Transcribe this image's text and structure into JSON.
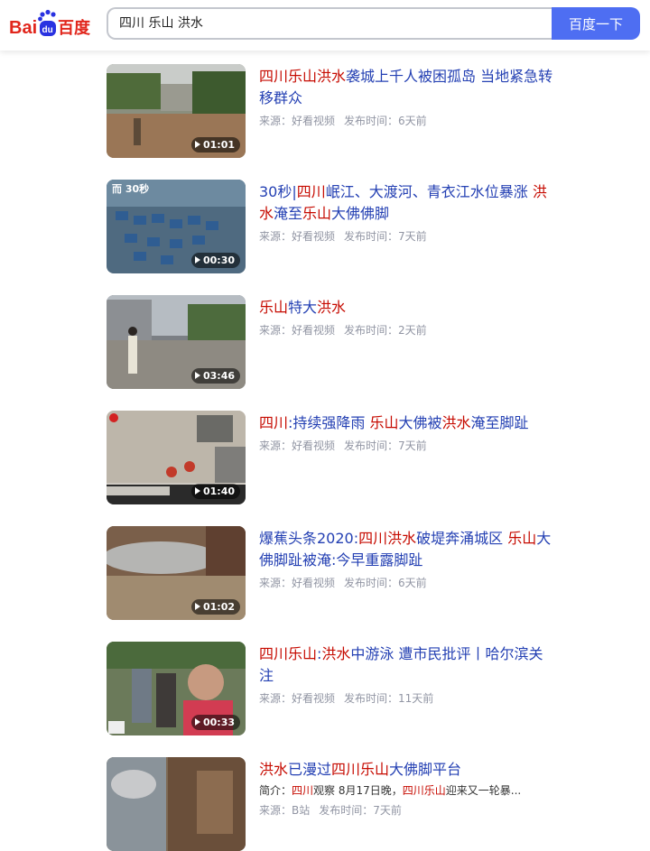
{
  "header": {
    "logo_text": "Bai百度",
    "search_value": "四川 乐山 洪水",
    "search_button": "百度一下"
  },
  "results": [
    {
      "title_parts": [
        {
          "text": "四川乐山洪水",
          "hl": true
        },
        {
          "text": "袭城上千人被困孤岛 当地紧急转移群众",
          "hl": false
        }
      ],
      "duration": "01:01",
      "source": "来源：好看视频",
      "time": "发布时间：6天前"
    },
    {
      "title_parts": [
        {
          "text": "30秒|",
          "hl": false
        },
        {
          "text": "四川",
          "hl": true
        },
        {
          "text": "岷江、大渡河、青衣江水位暴涨 ",
          "hl": false
        },
        {
          "text": "洪水",
          "hl": true
        },
        {
          "text": "淹至",
          "hl": false
        },
        {
          "text": "乐山",
          "hl": true
        },
        {
          "text": "大佛佛脚",
          "hl": false
        }
      ],
      "duration": "00:30",
      "source": "来源：好看视频",
      "time": "发布时间：7天前"
    },
    {
      "title_parts": [
        {
          "text": "乐山",
          "hl": true
        },
        {
          "text": "特大",
          "hl": false
        },
        {
          "text": "洪水",
          "hl": true
        }
      ],
      "duration": "03:46",
      "source": "来源：好看视频",
      "time": "发布时间：2天前"
    },
    {
      "title_parts": [
        {
          "text": "四川",
          "hl": true
        },
        {
          "text": ":持续强降雨 ",
          "hl": false
        },
        {
          "text": "乐山",
          "hl": true
        },
        {
          "text": "大佛被",
          "hl": false
        },
        {
          "text": "洪水",
          "hl": true
        },
        {
          "text": "淹至脚趾",
          "hl": false
        }
      ],
      "duration": "01:40",
      "source": "来源：好看视频",
      "time": "发布时间：7天前"
    },
    {
      "title_parts": [
        {
          "text": "爆蕉头条2020:",
          "hl": false
        },
        {
          "text": "四川洪水",
          "hl": true
        },
        {
          "text": "破堤奔涌城区 ",
          "hl": false
        },
        {
          "text": "乐山",
          "hl": true
        },
        {
          "text": "大佛脚趾被淹:今早重露脚趾",
          "hl": false
        }
      ],
      "duration": "01:02",
      "source": "来源：好看视频",
      "time": "发布时间：6天前"
    },
    {
      "title_parts": [
        {
          "text": "四川乐山",
          "hl": true
        },
        {
          "text": ":",
          "hl": false
        },
        {
          "text": "洪水",
          "hl": true
        },
        {
          "text": "中游泳 遭市民批评丨哈尔滨关注",
          "hl": false
        }
      ],
      "duration": "00:33",
      "source": "来源：好看视频",
      "time": "发布时间：11天前"
    },
    {
      "title_parts": [
        {
          "text": "洪水",
          "hl": true
        },
        {
          "text": "已漫过",
          "hl": false
        },
        {
          "text": "四川乐山",
          "hl": true
        },
        {
          "text": "大佛脚平台",
          "hl": false
        }
      ],
      "snippet_parts": [
        {
          "text": "简介：",
          "hl": false
        },
        {
          "text": "四川",
          "hl": true
        },
        {
          "text": "观察 8月17日晚，",
          "hl": false
        },
        {
          "text": "四川乐山",
          "hl": true
        },
        {
          "text": "迎来又一轮暴...",
          "hl": false
        }
      ],
      "duration": "",
      "source": "来源：B站",
      "time": "发布时间：7天前"
    }
  ],
  "colors": {
    "brand_blue": "#4e6ef2",
    "title_blue": "#2440b3",
    "highlight_red": "#c60a00",
    "meta_gray": "#9195a3"
  },
  "icons": [
    "baidu-paw-icon",
    "play-icon"
  ]
}
